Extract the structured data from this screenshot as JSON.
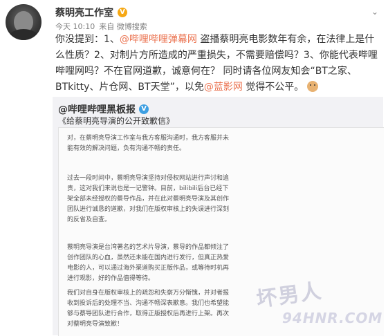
{
  "post": {
    "author": "蔡明亮工作室",
    "verified_badge": "V",
    "meta_time": "今天 10:10",
    "meta_source": "来自 微博搜索",
    "content": {
      "t1": "你没提到：1、",
      "link1": "@哔哩哔哩弹幕网",
      "t2": " 盗播蔡明亮电影数年有余，在法律上是什么性质？2、对制片方所造成的严重损失，不需要赔偿吗？3、你能代表哔哩哔哩网吗？不在官网道歉，诚意何在？ 同时请各位网友知会“BT之家、BTkitty、片仓网、BT天堂”，以免",
      "link2": "@蓝影网",
      "t3": " 觉得不公平。"
    }
  },
  "repost": {
    "author": "@哔哩哔哩黑板报",
    "verified_badge": "V",
    "title": "《给蔡明亮导演的公开致歉信》",
    "paragraphs": [
      "对，在蔡明亮导演工作室与我方客服沟通时，我方客服并未能有效的解决问题，负有沟通不畅的责任。",
      "过去一段时间中，蔡明亮导演坚持对侵权网站进行声讨和追责，这对我们来说也是一记警钟。目前，bilibili后台已经下架全部未经授权的蔡导作品，并在此对蔡明亮导演及其创作团队进行诚恳的道歉，对我们在版权审核上的失误进行深刻的反省及自查。",
      "蔡明亮导演是台湾著名的艺术片导演，蔡导的作品都倾注了创作团队的心血，虽然还未能在国内进行发行，但真正热爱电影的人，可以通过海外渠道购买正版作品，或等待时机再进行观影，好的作品值得等待。",
      "我们对自身在版权审核上的疏忽和失察万分惭愧，并对者报收到投诉后的处理不当、沟通不畅深表歉意。我们也希望能够与蔡导团队进行合作，取得正版授权后再进行上架。再次对蔡明亮导演致歉！"
    ]
  },
  "watermark": {
    "text1": "坏男人",
    "text2": "94HNR.COM"
  }
}
